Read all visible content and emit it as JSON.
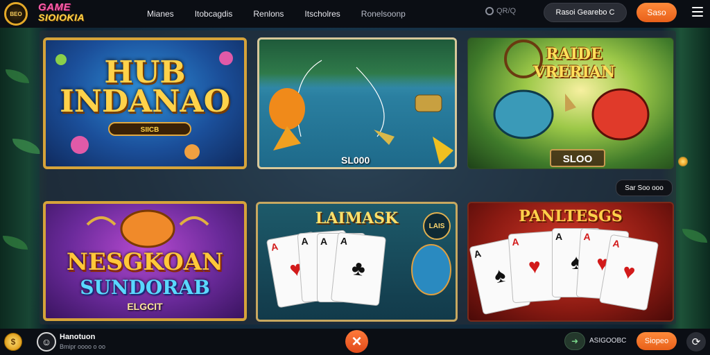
{
  "header": {
    "logo_badge": "BEO",
    "logo_line1": "GAME",
    "logo_line2": "SIOIOKIA",
    "nav": [
      "Mianes",
      "Itobcagdis",
      "Renlons",
      "Itscholres",
      "Ronelsoonp"
    ],
    "status_text": "QR/Q",
    "account_button": "Rasoi Gearebo C",
    "login_button": "Saso"
  },
  "games": [
    {
      "title": "HUB INDANAO",
      "subtitle": "SIICB"
    },
    {
      "badge": "SL000"
    },
    {
      "title": "RAIDE VRERIAN",
      "badge": "SLOO"
    },
    {
      "title": "NESGKOAN",
      "subtitle": "SUNDORAB",
      "badge": "ELGCIT"
    },
    {
      "title": "LAIMASK",
      "emblem": "LAIS"
    },
    {
      "title": "PANLTESGS"
    }
  ],
  "side_chip": "Sar Soo ooo",
  "cards": {
    "c5": [
      {
        "rank": "A",
        "suit": "♥",
        "red": true
      },
      {
        "rank": "A",
        "suit": "♠",
        "red": false
      },
      {
        "rank": "A",
        "suit": "♠",
        "red": false
      },
      {
        "rank": "A",
        "suit": "♣",
        "red": false
      }
    ],
    "c6": [
      {
        "rank": "A",
        "suit": "♠",
        "red": false
      },
      {
        "rank": "A",
        "suit": "♥",
        "red": true
      },
      {
        "rank": "A",
        "suit": "♠",
        "red": false
      },
      {
        "rank": "A",
        "suit": "♥",
        "red": true
      },
      {
        "rank": "A",
        "suit": "♥",
        "red": true
      }
    ]
  },
  "footer": {
    "coin": "$",
    "user_name": "Hanotuon",
    "user_sub": "Bmipr oooo o oo",
    "balance": "ASIGOOBC",
    "signup_button": "Siopeo"
  },
  "icons": {
    "close": "×",
    "share": "➜",
    "refresh": "⟳",
    "avatar": "☺"
  },
  "colors": {
    "accent": "#e8601a",
    "gold": "#d6a33a"
  }
}
